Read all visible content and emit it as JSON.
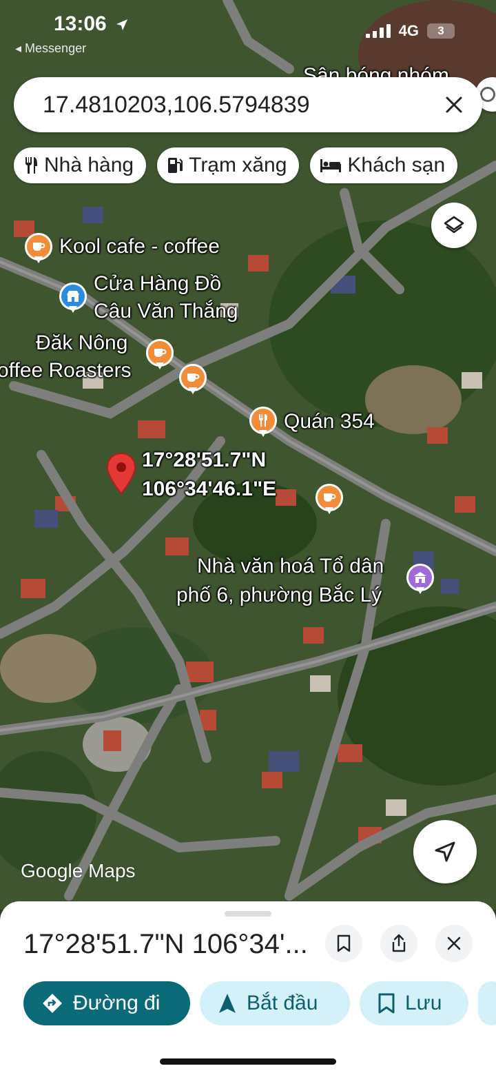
{
  "status_bar": {
    "time": "13:06",
    "back_app": "◂ Messenger",
    "network": "4G",
    "battery": "3"
  },
  "search": {
    "value": "17.4810203,106.5794839"
  },
  "chips": [
    {
      "label": "Nhà hàng",
      "icon": "restaurant-icon"
    },
    {
      "label": "Trạm xăng",
      "icon": "gas-station-icon"
    },
    {
      "label": "Khách sạn",
      "icon": "hotel-icon"
    }
  ],
  "map": {
    "labels": {
      "top_partial": "Sân bóng nhóm",
      "kool_cafe": "Kool cafe - coffee",
      "cua_hang_1": "Cửa Hàng Đồ",
      "cua_hang_2": "Câu Văn Thắng",
      "dak_nong_1": "Đăk Nông",
      "dak_nong_2": "offee Roasters",
      "quan_354": "Quán 354",
      "pin_lat": "17°28'51.7\"N",
      "pin_lng": "106°34'46.1\"E",
      "nha_van_hoa_1": "Nhà văn hoá Tổ dân",
      "nha_van_hoa_2": "phố 6, phường Bắc Lý"
    },
    "watermark": "Google Maps",
    "colors": {
      "cafe_pin": "#f28c38",
      "shop_pin": "#2a8ce0",
      "community_pin": "#a169d9",
      "dropped_pin": "#e53935"
    }
  },
  "sheet": {
    "title": "17°28'51.7\"N 106°34'...",
    "actions": {
      "directions": "Đường đi",
      "start": "Bắt đầu",
      "save": "Lưu"
    },
    "colors": {
      "primary": "#0b6a78",
      "secondary": "#d4f0f8"
    }
  }
}
